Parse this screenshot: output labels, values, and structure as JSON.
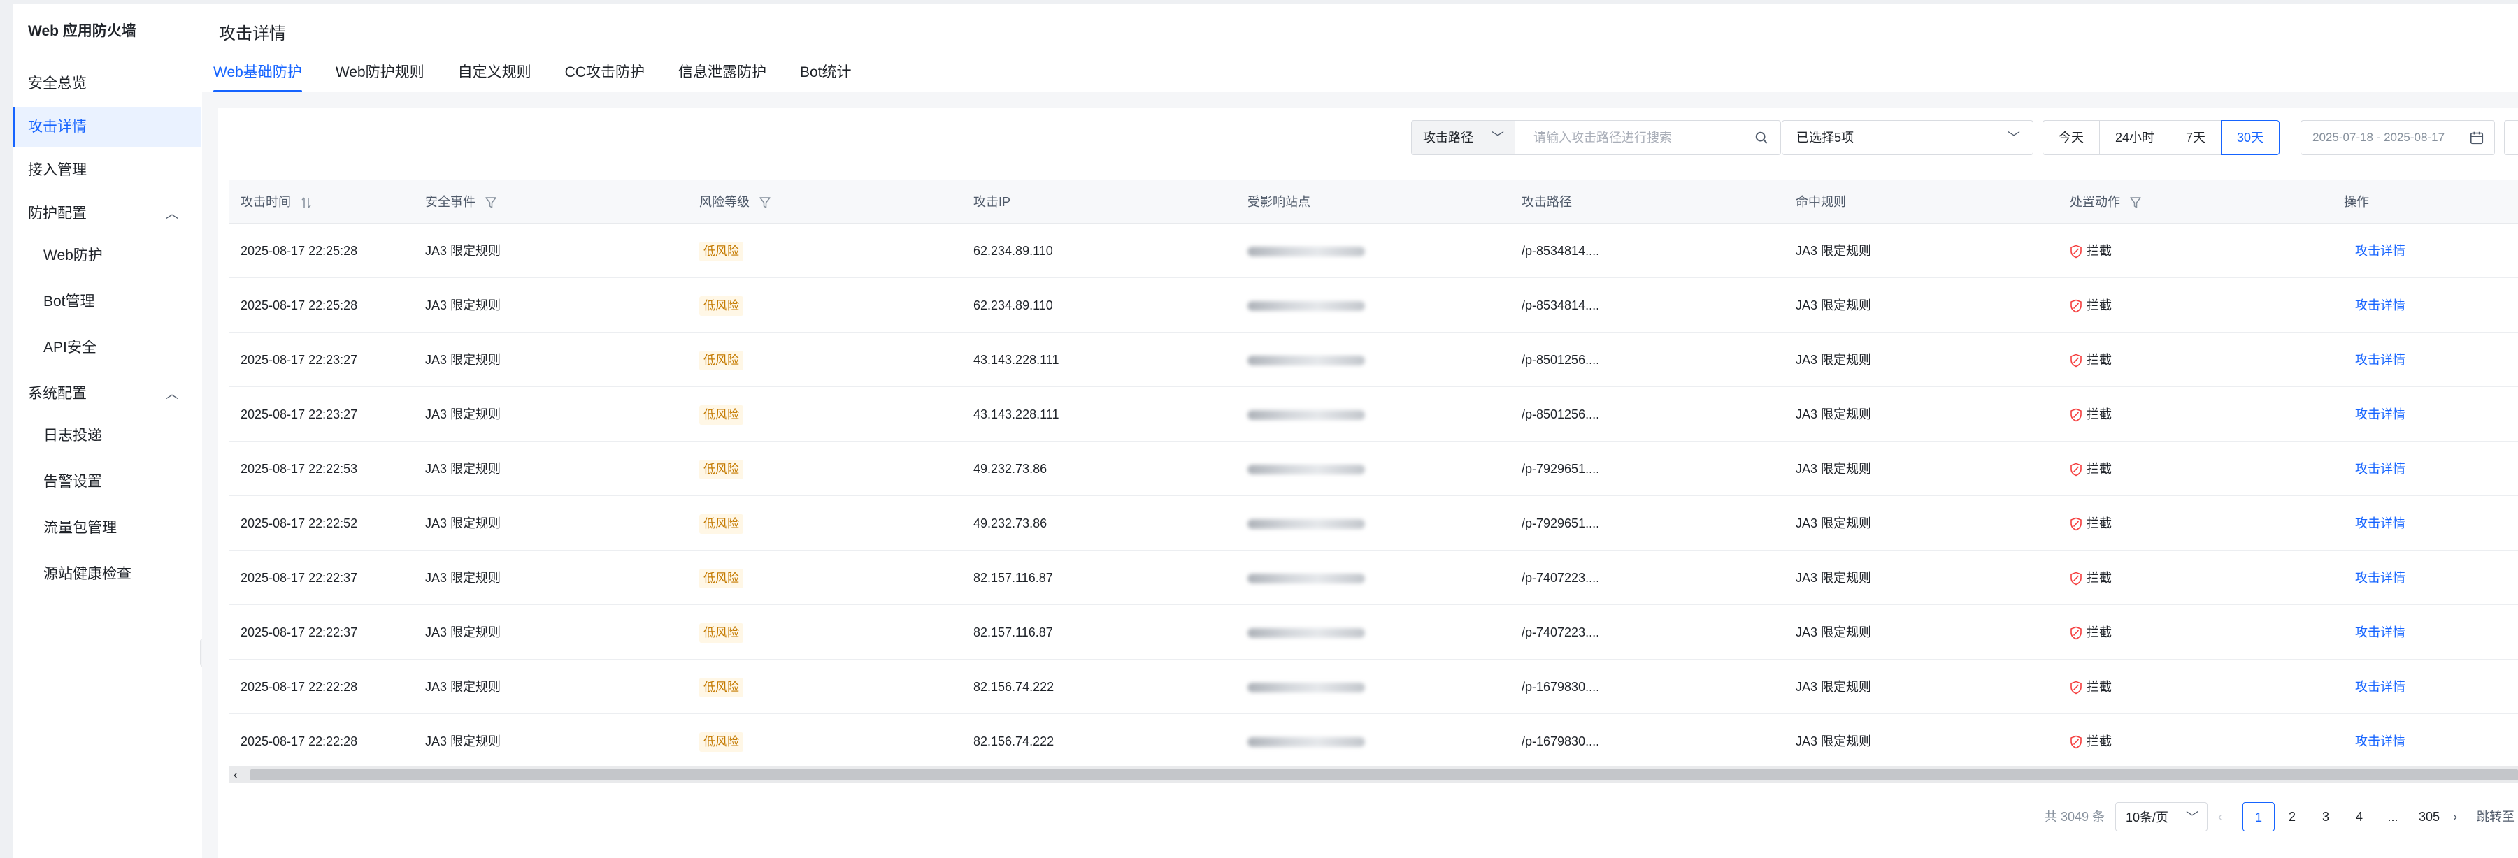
{
  "sidebar": {
    "title": "Web 应用防火墙",
    "items": [
      {
        "label": "安全总览"
      },
      {
        "label": "攻击详情"
      },
      {
        "label": "接入管理"
      },
      {
        "label": "防护配置"
      },
      {
        "label": "Web防护"
      },
      {
        "label": "Bot管理"
      },
      {
        "label": "API安全"
      },
      {
        "label": "系统配置"
      },
      {
        "label": "日志投递"
      },
      {
        "label": "告警设置"
      },
      {
        "label": "流量包管理"
      },
      {
        "label": "源站健康检查"
      }
    ]
  },
  "header": {
    "title": "攻击详情",
    "tabs": [
      {
        "label": "Web基础防护"
      },
      {
        "label": "Web防护规则"
      },
      {
        "label": "自定义规则"
      },
      {
        "label": "CC攻击防护"
      },
      {
        "label": "信息泄露防护"
      },
      {
        "label": "Bot统计"
      }
    ]
  },
  "toolbar": {
    "path_select": "攻击路径",
    "search_placeholder": "请输入攻击路径进行搜索",
    "event_select": "已选择5项",
    "ranges": [
      "今天",
      "24小时",
      "7天",
      "30天"
    ],
    "active_range": "30天",
    "date_range": "2025-07-18 - 2025-08-17"
  },
  "table": {
    "columns": [
      "攻击时间",
      "安全事件",
      "风险等级",
      "攻击IP",
      "受影响站点",
      "攻击路径",
      "命中规则",
      "处置动作",
      "操作"
    ],
    "rows": [
      {
        "time": "2025-08-17 22:25:28",
        "event": "JA3 限定规则",
        "risk": "低风险",
        "ip": "62.234.89.110",
        "path": "/p-8534814....",
        "rule": "JA3 限定规则",
        "action": "拦截",
        "op": "攻击详情"
      },
      {
        "time": "2025-08-17 22:25:28",
        "event": "JA3 限定规则",
        "risk": "低风险",
        "ip": "62.234.89.110",
        "path": "/p-8534814....",
        "rule": "JA3 限定规则",
        "action": "拦截",
        "op": "攻击详情"
      },
      {
        "time": "2025-08-17 22:23:27",
        "event": "JA3 限定规则",
        "risk": "低风险",
        "ip": "43.143.228.111",
        "path": "/p-8501256....",
        "rule": "JA3 限定规则",
        "action": "拦截",
        "op": "攻击详情"
      },
      {
        "time": "2025-08-17 22:23:27",
        "event": "JA3 限定规则",
        "risk": "低风险",
        "ip": "43.143.228.111",
        "path": "/p-8501256....",
        "rule": "JA3 限定规则",
        "action": "拦截",
        "op": "攻击详情"
      },
      {
        "time": "2025-08-17 22:22:53",
        "event": "JA3 限定规则",
        "risk": "低风险",
        "ip": "49.232.73.86",
        "path": "/p-7929651....",
        "rule": "JA3 限定规则",
        "action": "拦截",
        "op": "攻击详情"
      },
      {
        "time": "2025-08-17 22:22:52",
        "event": "JA3 限定规则",
        "risk": "低风险",
        "ip": "49.232.73.86",
        "path": "/p-7929651....",
        "rule": "JA3 限定规则",
        "action": "拦截",
        "op": "攻击详情"
      },
      {
        "time": "2025-08-17 22:22:37",
        "event": "JA3 限定规则",
        "risk": "低风险",
        "ip": "82.157.116.87",
        "path": "/p-7407223....",
        "rule": "JA3 限定规则",
        "action": "拦截",
        "op": "攻击详情"
      },
      {
        "time": "2025-08-17 22:22:37",
        "event": "JA3 限定规则",
        "risk": "低风险",
        "ip": "82.157.116.87",
        "path": "/p-7407223....",
        "rule": "JA3 限定规则",
        "action": "拦截",
        "op": "攻击详情"
      },
      {
        "time": "2025-08-17 22:22:28",
        "event": "JA3 限定规则",
        "risk": "低风险",
        "ip": "82.156.74.222",
        "path": "/p-1679830....",
        "rule": "JA3 限定规则",
        "action": "拦截",
        "op": "攻击详情"
      },
      {
        "time": "2025-08-17 22:22:28",
        "event": "JA3 限定规则",
        "risk": "低风险",
        "ip": "82.156.74.222",
        "path": "/p-1679830....",
        "rule": "JA3 限定规则",
        "action": "拦截",
        "op": "攻击详情"
      }
    ]
  },
  "pagination": {
    "total": "共 3049 条",
    "page_size": "10条/页",
    "pages": [
      "1",
      "2",
      "3",
      "4",
      "...",
      "305"
    ],
    "current": "1",
    "jump_label": "跳转至"
  },
  "colors": {
    "accent": "#1664ff",
    "risk_low_bg": "#fff7e6",
    "risk_low_text": "#c47a00",
    "block_icon": "#f53f3f"
  },
  "icons": {
    "sort": "sort-icon",
    "filter": "filter-icon",
    "search": "search-icon",
    "calendar": "calendar-icon",
    "block": "shield-block-icon"
  }
}
